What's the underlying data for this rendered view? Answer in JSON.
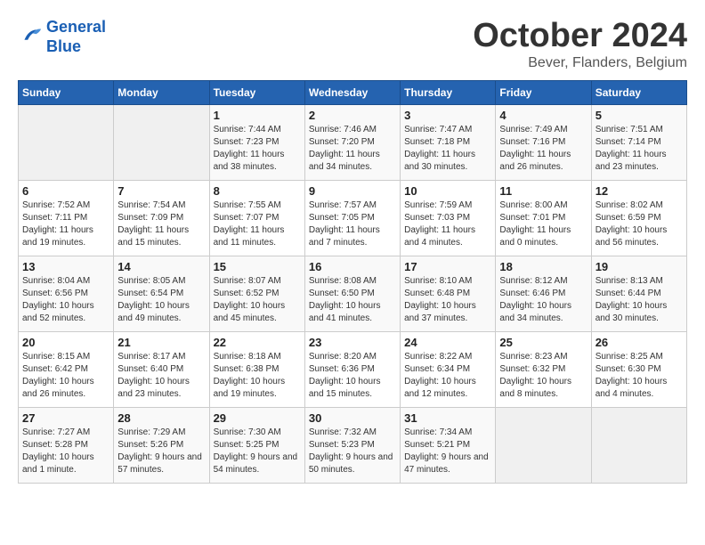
{
  "logo": {
    "line1": "General",
    "line2": "Blue"
  },
  "title": "October 2024",
  "subtitle": "Bever, Flanders, Belgium",
  "days_header": [
    "Sunday",
    "Monday",
    "Tuesday",
    "Wednesday",
    "Thursday",
    "Friday",
    "Saturday"
  ],
  "weeks": [
    [
      {
        "day": "",
        "sunrise": "",
        "sunset": "",
        "daylight": ""
      },
      {
        "day": "",
        "sunrise": "",
        "sunset": "",
        "daylight": ""
      },
      {
        "day": "1",
        "sunrise": "Sunrise: 7:44 AM",
        "sunset": "Sunset: 7:23 PM",
        "daylight": "Daylight: 11 hours and 38 minutes."
      },
      {
        "day": "2",
        "sunrise": "Sunrise: 7:46 AM",
        "sunset": "Sunset: 7:20 PM",
        "daylight": "Daylight: 11 hours and 34 minutes."
      },
      {
        "day": "3",
        "sunrise": "Sunrise: 7:47 AM",
        "sunset": "Sunset: 7:18 PM",
        "daylight": "Daylight: 11 hours and 30 minutes."
      },
      {
        "day": "4",
        "sunrise": "Sunrise: 7:49 AM",
        "sunset": "Sunset: 7:16 PM",
        "daylight": "Daylight: 11 hours and 26 minutes."
      },
      {
        "day": "5",
        "sunrise": "Sunrise: 7:51 AM",
        "sunset": "Sunset: 7:14 PM",
        "daylight": "Daylight: 11 hours and 23 minutes."
      }
    ],
    [
      {
        "day": "6",
        "sunrise": "Sunrise: 7:52 AM",
        "sunset": "Sunset: 7:11 PM",
        "daylight": "Daylight: 11 hours and 19 minutes."
      },
      {
        "day": "7",
        "sunrise": "Sunrise: 7:54 AM",
        "sunset": "Sunset: 7:09 PM",
        "daylight": "Daylight: 11 hours and 15 minutes."
      },
      {
        "day": "8",
        "sunrise": "Sunrise: 7:55 AM",
        "sunset": "Sunset: 7:07 PM",
        "daylight": "Daylight: 11 hours and 11 minutes."
      },
      {
        "day": "9",
        "sunrise": "Sunrise: 7:57 AM",
        "sunset": "Sunset: 7:05 PM",
        "daylight": "Daylight: 11 hours and 7 minutes."
      },
      {
        "day": "10",
        "sunrise": "Sunrise: 7:59 AM",
        "sunset": "Sunset: 7:03 PM",
        "daylight": "Daylight: 11 hours and 4 minutes."
      },
      {
        "day": "11",
        "sunrise": "Sunrise: 8:00 AM",
        "sunset": "Sunset: 7:01 PM",
        "daylight": "Daylight: 11 hours and 0 minutes."
      },
      {
        "day": "12",
        "sunrise": "Sunrise: 8:02 AM",
        "sunset": "Sunset: 6:59 PM",
        "daylight": "Daylight: 10 hours and 56 minutes."
      }
    ],
    [
      {
        "day": "13",
        "sunrise": "Sunrise: 8:04 AM",
        "sunset": "Sunset: 6:56 PM",
        "daylight": "Daylight: 10 hours and 52 minutes."
      },
      {
        "day": "14",
        "sunrise": "Sunrise: 8:05 AM",
        "sunset": "Sunset: 6:54 PM",
        "daylight": "Daylight: 10 hours and 49 minutes."
      },
      {
        "day": "15",
        "sunrise": "Sunrise: 8:07 AM",
        "sunset": "Sunset: 6:52 PM",
        "daylight": "Daylight: 10 hours and 45 minutes."
      },
      {
        "day": "16",
        "sunrise": "Sunrise: 8:08 AM",
        "sunset": "Sunset: 6:50 PM",
        "daylight": "Daylight: 10 hours and 41 minutes."
      },
      {
        "day": "17",
        "sunrise": "Sunrise: 8:10 AM",
        "sunset": "Sunset: 6:48 PM",
        "daylight": "Daylight: 10 hours and 37 minutes."
      },
      {
        "day": "18",
        "sunrise": "Sunrise: 8:12 AM",
        "sunset": "Sunset: 6:46 PM",
        "daylight": "Daylight: 10 hours and 34 minutes."
      },
      {
        "day": "19",
        "sunrise": "Sunrise: 8:13 AM",
        "sunset": "Sunset: 6:44 PM",
        "daylight": "Daylight: 10 hours and 30 minutes."
      }
    ],
    [
      {
        "day": "20",
        "sunrise": "Sunrise: 8:15 AM",
        "sunset": "Sunset: 6:42 PM",
        "daylight": "Daylight: 10 hours and 26 minutes."
      },
      {
        "day": "21",
        "sunrise": "Sunrise: 8:17 AM",
        "sunset": "Sunset: 6:40 PM",
        "daylight": "Daylight: 10 hours and 23 minutes."
      },
      {
        "day": "22",
        "sunrise": "Sunrise: 8:18 AM",
        "sunset": "Sunset: 6:38 PM",
        "daylight": "Daylight: 10 hours and 19 minutes."
      },
      {
        "day": "23",
        "sunrise": "Sunrise: 8:20 AM",
        "sunset": "Sunset: 6:36 PM",
        "daylight": "Daylight: 10 hours and 15 minutes."
      },
      {
        "day": "24",
        "sunrise": "Sunrise: 8:22 AM",
        "sunset": "Sunset: 6:34 PM",
        "daylight": "Daylight: 10 hours and 12 minutes."
      },
      {
        "day": "25",
        "sunrise": "Sunrise: 8:23 AM",
        "sunset": "Sunset: 6:32 PM",
        "daylight": "Daylight: 10 hours and 8 minutes."
      },
      {
        "day": "26",
        "sunrise": "Sunrise: 8:25 AM",
        "sunset": "Sunset: 6:30 PM",
        "daylight": "Daylight: 10 hours and 4 minutes."
      }
    ],
    [
      {
        "day": "27",
        "sunrise": "Sunrise: 7:27 AM",
        "sunset": "Sunset: 5:28 PM",
        "daylight": "Daylight: 10 hours and 1 minute."
      },
      {
        "day": "28",
        "sunrise": "Sunrise: 7:29 AM",
        "sunset": "Sunset: 5:26 PM",
        "daylight": "Daylight: 9 hours and 57 minutes."
      },
      {
        "day": "29",
        "sunrise": "Sunrise: 7:30 AM",
        "sunset": "Sunset: 5:25 PM",
        "daylight": "Daylight: 9 hours and 54 minutes."
      },
      {
        "day": "30",
        "sunrise": "Sunrise: 7:32 AM",
        "sunset": "Sunset: 5:23 PM",
        "daylight": "Daylight: 9 hours and 50 minutes."
      },
      {
        "day": "31",
        "sunrise": "Sunrise: 7:34 AM",
        "sunset": "Sunset: 5:21 PM",
        "daylight": "Daylight: 9 hours and 47 minutes."
      },
      {
        "day": "",
        "sunrise": "",
        "sunset": "",
        "daylight": ""
      },
      {
        "day": "",
        "sunrise": "",
        "sunset": "",
        "daylight": ""
      }
    ]
  ]
}
